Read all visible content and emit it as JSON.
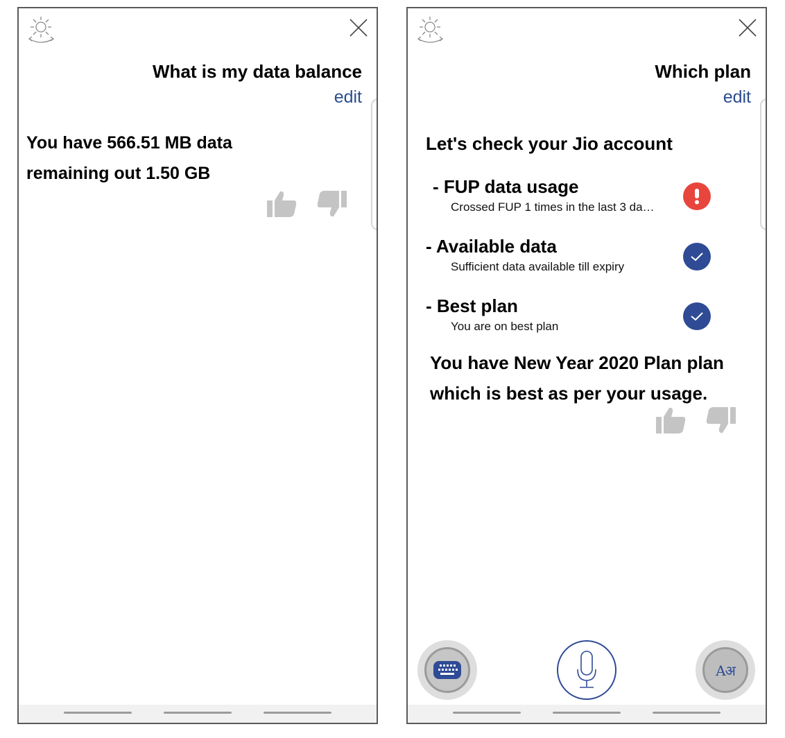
{
  "left_screen": {
    "user_query": "What is my data balance",
    "edit_label": "edit",
    "answer_line1": "You have 566.51 MB data",
    "answer_line2": "remaining out 1.50 GB"
  },
  "right_screen": {
    "user_query": "Which plan",
    "edit_label": "edit",
    "intro": "Let's check your Jio account",
    "checks": [
      {
        "title": "- FUP data usage",
        "detail": "Crossed FUP 1 times in the last 3 da…",
        "status": "alert",
        "status_icon": "exclamation"
      },
      {
        "title": "- Available data",
        "detail": "Sufficient data available till expiry",
        "status": "ok",
        "status_icon": "checkmark"
      },
      {
        "title": "- Best plan",
        "detail": "You are on best plan",
        "status": "ok",
        "status_icon": "checkmark"
      }
    ],
    "summary_line1": "You have New Year 2020 Plan plan",
    "summary_line2": "which is best as per your usage.",
    "language_button_glyph": "Aअ"
  },
  "colors": {
    "accent_blue": "#2a4d8f",
    "check_blue": "#2f4b95",
    "alert_red": "#e8453c",
    "feedback_grey": "#c4c4c4"
  },
  "icons": [
    "brightness-icon",
    "close-icon",
    "thumbs-up-icon",
    "thumbs-down-icon",
    "check-icon",
    "alert-icon",
    "keyboard-icon",
    "microphone-icon",
    "language-icon"
  ]
}
